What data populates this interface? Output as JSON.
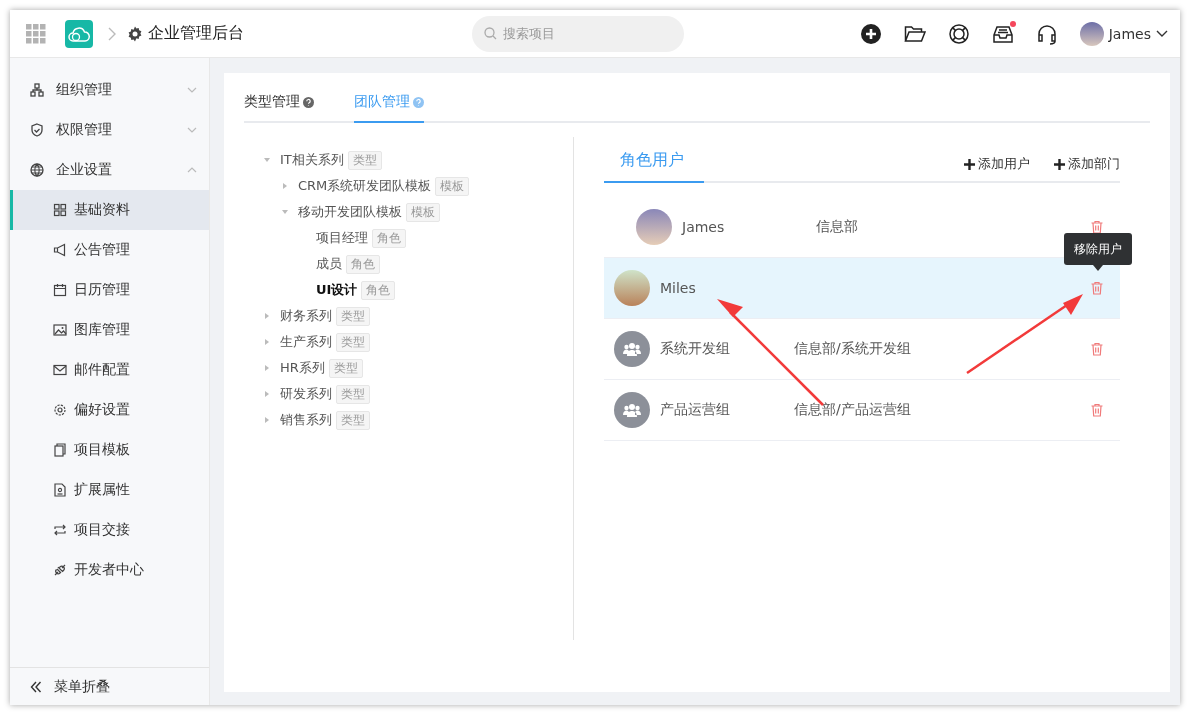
{
  "header": {
    "title": "企业管理后台",
    "search": {
      "placeholder": "搜索项目"
    },
    "inbox_badge": true,
    "user": {
      "name": "James"
    }
  },
  "sidebar": {
    "items": [
      {
        "label": "组织管理",
        "expanded": false
      },
      {
        "label": "权限管理",
        "expanded": false
      },
      {
        "label": "企业设置",
        "expanded": true,
        "children": [
          {
            "label": "基础资料",
            "selected": true
          },
          {
            "label": "公告管理",
            "selected": false
          },
          {
            "label": "日历管理",
            "selected": false
          },
          {
            "label": "图库管理",
            "selected": false
          },
          {
            "label": "邮件配置",
            "selected": false
          },
          {
            "label": "偏好设置",
            "selected": false
          },
          {
            "label": "项目模板",
            "selected": false
          },
          {
            "label": "扩展属性",
            "selected": false
          },
          {
            "label": "项目交接",
            "selected": false
          },
          {
            "label": "开发者中心",
            "selected": false
          }
        ]
      }
    ],
    "collapse": "菜单折叠"
  },
  "tabs": [
    {
      "label": "类型管理",
      "selected": false
    },
    {
      "label": "团队管理",
      "selected": true
    }
  ],
  "tree": [
    {
      "label": "IT相关系列",
      "tag": "类型",
      "expanded": true,
      "selected": false,
      "children": [
        {
          "label": "CRM系统研发团队模板",
          "tag": "模板",
          "expanded": false,
          "selected": false
        },
        {
          "label": "移动开发团队模板",
          "tag": "模板",
          "expanded": true,
          "selected": false,
          "children": [
            {
              "label": "项目经理",
              "tag": "角色",
              "selected": false
            },
            {
              "label": "成员",
              "tag": "角色",
              "selected": false
            },
            {
              "label": "UI设计",
              "tag": "角色",
              "selected": true
            }
          ]
        }
      ]
    },
    {
      "label": "财务系列",
      "tag": "类型",
      "expanded": false,
      "selected": false
    },
    {
      "label": "生产系列",
      "tag": "类型",
      "expanded": false,
      "selected": false
    },
    {
      "label": "HR系列",
      "tag": "类型",
      "expanded": false,
      "selected": false
    },
    {
      "label": "研发系列",
      "tag": "类型",
      "expanded": false,
      "selected": false
    },
    {
      "label": "销售系列",
      "tag": "类型",
      "expanded": false,
      "selected": false
    }
  ],
  "role_panel": {
    "tab": "角色用户",
    "actions": [
      "添加用户",
      "添加部门"
    ],
    "members": [
      {
        "kind": "user",
        "name": "James",
        "department": "信息部",
        "selected": false
      },
      {
        "kind": "user",
        "name": "Miles",
        "selected": true,
        "tooltip": "移除用户"
      },
      {
        "kind": "group",
        "name": "系统开发组",
        "department": "信息部/系统开发组",
        "selected": false
      },
      {
        "kind": "group",
        "name": "产品运营组",
        "department": "信息部/产品运营组",
        "selected": false
      }
    ]
  }
}
